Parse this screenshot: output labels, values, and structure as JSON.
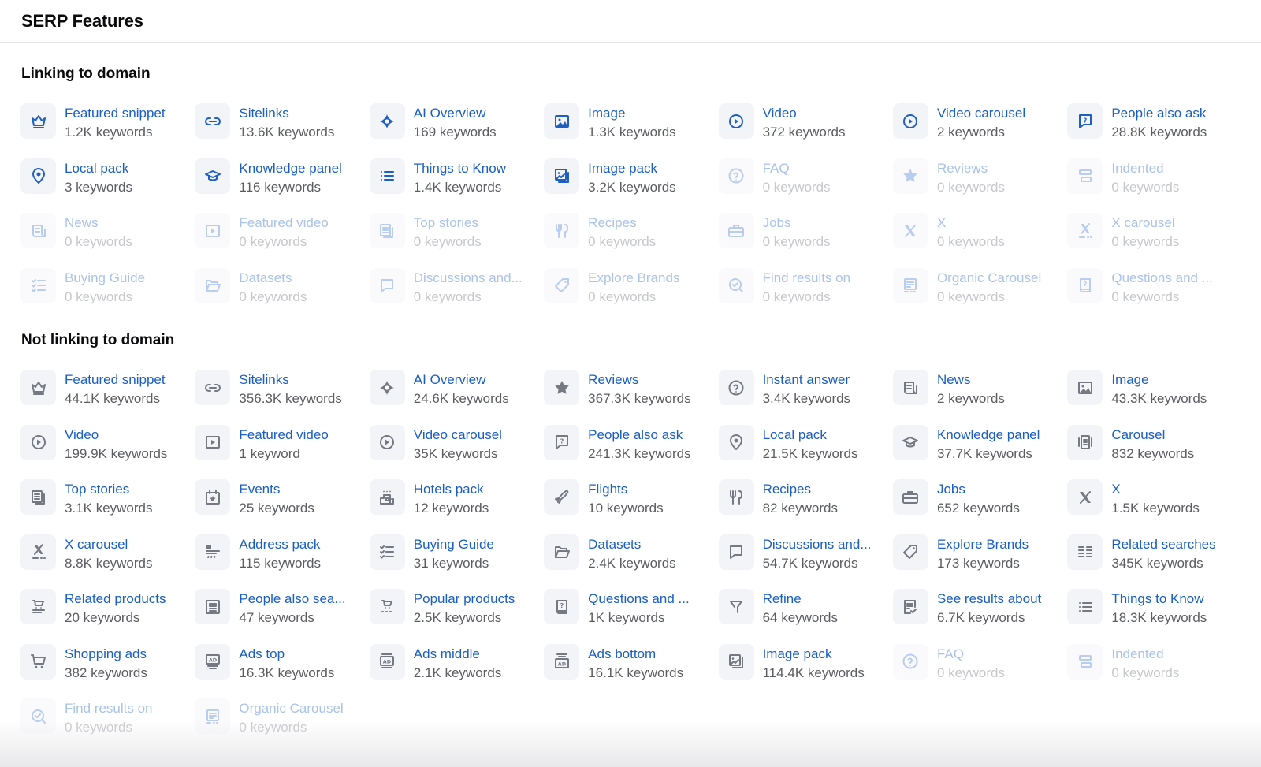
{
  "header": {
    "title": "SERP Features"
  },
  "sections": {
    "linking": {
      "title": "Linking to domain",
      "items": [
        {
          "label": "Featured snippet",
          "count": "1.2K keywords",
          "icon": "crown-icon",
          "empty": false
        },
        {
          "label": "Sitelinks",
          "count": "13.6K keywords",
          "icon": "link-icon",
          "empty": false
        },
        {
          "label": "AI Overview",
          "count": "169 keywords",
          "icon": "sparkle-icon",
          "empty": false
        },
        {
          "label": "Image",
          "count": "1.3K keywords",
          "icon": "image-icon",
          "empty": false
        },
        {
          "label": "Video",
          "count": "372 keywords",
          "icon": "play-circle-icon",
          "empty": false
        },
        {
          "label": "Video carousel",
          "count": "2 keywords",
          "icon": "play-circle-icon",
          "empty": false
        },
        {
          "label": "People also ask",
          "count": "28.8K keywords",
          "icon": "question-bubble-icon",
          "empty": false
        },
        {
          "label": "Local pack",
          "count": "3 keywords",
          "icon": "map-pin-icon",
          "empty": false
        },
        {
          "label": "Knowledge panel",
          "count": "116 keywords",
          "icon": "graduation-cap-icon",
          "empty": false
        },
        {
          "label": "Things to Know",
          "count": "1.4K keywords",
          "icon": "list-icon",
          "empty": false
        },
        {
          "label": "Image pack",
          "count": "3.2K keywords",
          "icon": "image-stack-icon",
          "empty": false
        },
        {
          "label": "FAQ",
          "count": "0 keywords",
          "icon": "question-circle-icon",
          "empty": true
        },
        {
          "label": "Reviews",
          "count": "0 keywords",
          "icon": "star-icon",
          "empty": true
        },
        {
          "label": "Indented",
          "count": "0 keywords",
          "icon": "indented-icon",
          "empty": true
        },
        {
          "label": "News",
          "count": "0 keywords",
          "icon": "newspaper-icon",
          "empty": true
        },
        {
          "label": "Featured video",
          "count": "0 keywords",
          "icon": "play-square-icon",
          "empty": true
        },
        {
          "label": "Top stories",
          "count": "0 keywords",
          "icon": "stories-icon",
          "empty": true
        },
        {
          "label": "Recipes",
          "count": "0 keywords",
          "icon": "fork-knife-icon",
          "empty": true
        },
        {
          "label": "Jobs",
          "count": "0 keywords",
          "icon": "briefcase-icon",
          "empty": true
        },
        {
          "label": "X",
          "count": "0 keywords",
          "icon": "x-logo-icon",
          "empty": true
        },
        {
          "label": "X carousel",
          "count": "0 keywords",
          "icon": "x-carousel-icon",
          "empty": true
        },
        {
          "label": "Buying Guide",
          "count": "0 keywords",
          "icon": "checklist-icon",
          "empty": true
        },
        {
          "label": "Datasets",
          "count": "0 keywords",
          "icon": "folder-open-icon",
          "empty": true
        },
        {
          "label": "Discussions and...",
          "count": "0 keywords",
          "icon": "chat-icon",
          "empty": true
        },
        {
          "label": "Explore Brands",
          "count": "0 keywords",
          "icon": "tag-icon",
          "empty": true
        },
        {
          "label": "Find results on",
          "count": "0 keywords",
          "icon": "search-check-icon",
          "empty": true
        },
        {
          "label": "Organic Carousel",
          "count": "0 keywords",
          "icon": "organic-carousel-icon",
          "empty": true
        },
        {
          "label": "Questions and ...",
          "count": "0 keywords",
          "icon": "question-book-icon",
          "empty": true
        }
      ]
    },
    "notlinking": {
      "title": "Not linking to domain",
      "items": [
        {
          "label": "Featured snippet",
          "count": "44.1K keywords",
          "icon": "crown-icon",
          "empty": false
        },
        {
          "label": "Sitelinks",
          "count": "356.3K keywords",
          "icon": "link-icon",
          "empty": false
        },
        {
          "label": "AI Overview",
          "count": "24.6K keywords",
          "icon": "sparkle-icon",
          "empty": false
        },
        {
          "label": "Reviews",
          "count": "367.3K keywords",
          "icon": "star-icon",
          "empty": false
        },
        {
          "label": "Instant answer",
          "count": "3.4K keywords",
          "icon": "question-circle-icon",
          "empty": false
        },
        {
          "label": "News",
          "count": "2 keywords",
          "icon": "newspaper-icon",
          "empty": false
        },
        {
          "label": "Image",
          "count": "43.3K keywords",
          "icon": "image-icon",
          "empty": false
        },
        {
          "label": "Video",
          "count": "199.9K keywords",
          "icon": "play-circle-icon",
          "empty": false
        },
        {
          "label": "Featured video",
          "count": "1 keyword",
          "icon": "play-square-icon",
          "empty": false
        },
        {
          "label": "Video carousel",
          "count": "35K keywords",
          "icon": "play-circle-icon",
          "empty": false
        },
        {
          "label": "People also ask",
          "count": "241.3K keywords",
          "icon": "question-bubble-icon",
          "empty": false
        },
        {
          "label": "Local pack",
          "count": "21.5K keywords",
          "icon": "map-pin-icon",
          "empty": false
        },
        {
          "label": "Knowledge panel",
          "count": "37.7K keywords",
          "icon": "graduation-cap-icon",
          "empty": false
        },
        {
          "label": "Carousel",
          "count": "832 keywords",
          "icon": "carousel-icon",
          "empty": false
        },
        {
          "label": "Top stories",
          "count": "3.1K keywords",
          "icon": "stories-icon",
          "empty": false
        },
        {
          "label": "Events",
          "count": "25 keywords",
          "icon": "calendar-star-icon",
          "empty": false
        },
        {
          "label": "Hotels pack",
          "count": "12 keywords",
          "icon": "hotel-icon",
          "empty": false
        },
        {
          "label": "Flights",
          "count": "10 keywords",
          "icon": "plane-icon",
          "empty": false
        },
        {
          "label": "Recipes",
          "count": "82 keywords",
          "icon": "fork-knife-icon",
          "empty": false
        },
        {
          "label": "Jobs",
          "count": "652 keywords",
          "icon": "briefcase-icon",
          "empty": false
        },
        {
          "label": "X",
          "count": "1.5K keywords",
          "icon": "x-logo-icon",
          "empty": false
        },
        {
          "label": "X carousel",
          "count": "8.8K keywords",
          "icon": "x-carousel-icon",
          "empty": false
        },
        {
          "label": "Address pack",
          "count": "115 keywords",
          "icon": "address-icon",
          "empty": false
        },
        {
          "label": "Buying Guide",
          "count": "31 keywords",
          "icon": "checklist-icon",
          "empty": false
        },
        {
          "label": "Datasets",
          "count": "2.4K keywords",
          "icon": "folder-open-icon",
          "empty": false
        },
        {
          "label": "Discussions and...",
          "count": "54.7K keywords",
          "icon": "chat-icon",
          "empty": false
        },
        {
          "label": "Explore Brands",
          "count": "173 keywords",
          "icon": "tag-icon",
          "empty": false
        },
        {
          "label": "Related searches",
          "count": "345K keywords",
          "icon": "two-column-list-icon",
          "empty": false
        },
        {
          "label": "Related products",
          "count": "20 keywords",
          "icon": "cart-list-icon",
          "empty": false
        },
        {
          "label": "People also sea...",
          "count": "47 keywords",
          "icon": "document-icon",
          "empty": false
        },
        {
          "label": "Popular products",
          "count": "2.5K keywords",
          "icon": "cart-stars-icon",
          "empty": false
        },
        {
          "label": "Questions and ...",
          "count": "1K keywords",
          "icon": "question-book-icon",
          "empty": false
        },
        {
          "label": "Refine",
          "count": "64 keywords",
          "icon": "filter-icon",
          "empty": false
        },
        {
          "label": "See results about",
          "count": "6.7K keywords",
          "icon": "document-check-icon",
          "empty": false
        },
        {
          "label": "Things to Know",
          "count": "18.3K keywords",
          "icon": "list-icon",
          "empty": false
        },
        {
          "label": "Shopping ads",
          "count": "382 keywords",
          "icon": "cart-icon",
          "empty": false
        },
        {
          "label": "Ads top",
          "count": "16.3K keywords",
          "icon": "ad-top-icon",
          "empty": false
        },
        {
          "label": "Ads middle",
          "count": "2.1K keywords",
          "icon": "ad-middle-icon",
          "empty": false
        },
        {
          "label": "Ads bottom",
          "count": "16.1K keywords",
          "icon": "ad-bottom-icon",
          "empty": false
        },
        {
          "label": "Image pack",
          "count": "114.4K keywords",
          "icon": "image-stack-icon",
          "empty": false
        },
        {
          "label": "FAQ",
          "count": "0 keywords",
          "icon": "question-circle-icon",
          "empty": true
        },
        {
          "label": "Indented",
          "count": "0 keywords",
          "icon": "indented-icon",
          "empty": true
        },
        {
          "label": "Find results on",
          "count": "0 keywords",
          "icon": "search-check-icon",
          "empty": true
        },
        {
          "label": "Organic Carousel",
          "count": "0 keywords",
          "icon": "organic-carousel-icon",
          "empty": true
        }
      ]
    }
  },
  "colors": {
    "link": "#1a5fc1",
    "icon_linking": "#1f5fc4",
    "icon_notlinking": "#767882",
    "muted_title": "#aac3ea",
    "muted_count": "#c7c8cc",
    "count": "#5c5d63",
    "icon_bg": "#f3f4f8"
  }
}
